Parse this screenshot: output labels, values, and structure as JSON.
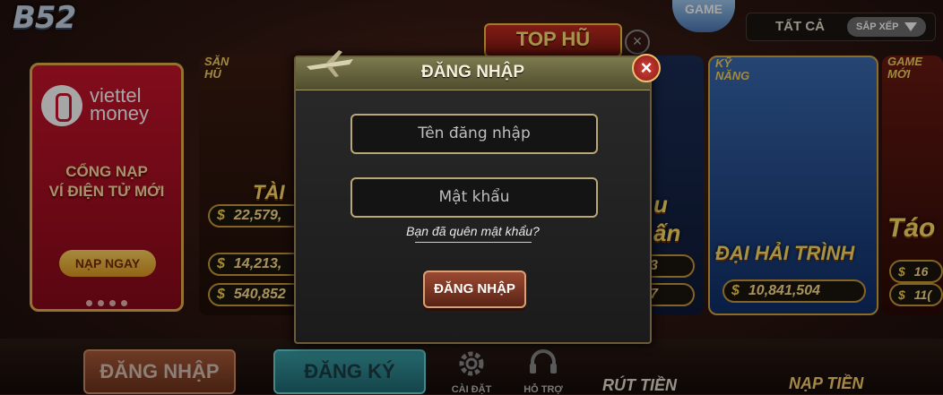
{
  "app": {
    "logo": "B52"
  },
  "top": {
    "tophu_label": "TOP HŨ",
    "game_badge": "GAME",
    "filter_label": "TẤT CẢ",
    "sort_label": "SẮP XẾP"
  },
  "promo": {
    "brand": "viettel\nmoney",
    "text": "CỔNG NẠP\nVÍ ĐIỆN TỬ MỚI",
    "button": "NẠP NGAY"
  },
  "cards": [
    {
      "tag": "SĂN\nHŨ",
      "title": "TÀI XỈU",
      "jackpots": [
        "22,579,",
        "14,213,",
        "540,852"
      ]
    },
    {
      "tag": "",
      "title": "u\nấn",
      "jackpots": [
        "3",
        "7"
      ]
    },
    {
      "tag": "KỸ\nNĂNG",
      "title": "ĐẠI HẢI TRÌNH",
      "jackpots": [
        "10,841,504"
      ]
    },
    {
      "tag": "GAME\nMỚI",
      "title": "Táo",
      "jackpots": [
        "16",
        "11("
      ]
    }
  ],
  "bottom": {
    "login": "ĐĂNG NHẬP",
    "register": "ĐĂNG KÝ",
    "settings": "CÀI ĐẶT",
    "support": "HỖ TRỢ",
    "withdraw": "RÚT TIỀN",
    "deposit": "NẠP TIỀN"
  },
  "dialog": {
    "title": "ĐĂNG NHẬP",
    "username_placeholder": "Tên đăng nhập",
    "password_placeholder": "Mật khẩu",
    "forgot": "Bạn đã quên mật khẩu?",
    "submit": "ĐĂNG NHẬP"
  },
  "colors": {
    "accent_gold": "#f1c441",
    "dialog_border": "#b9a778",
    "close_red": "#d0423a"
  }
}
